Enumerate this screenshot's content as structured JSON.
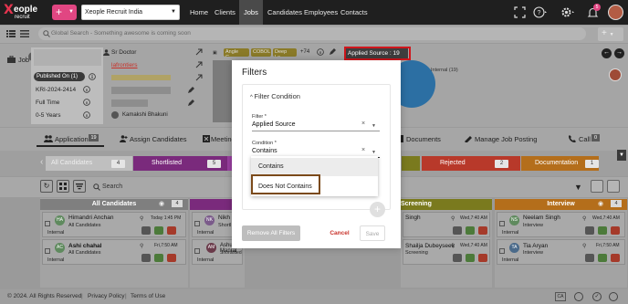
{
  "topbar": {
    "logo_x": "X",
    "logo_eople": "eople",
    "logo_recruit": "recruit",
    "add_label": "+",
    "company": "Xeople Recruit India",
    "nav": [
      "Home",
      "Clients",
      "Jobs",
      "Candidates",
      "Employees",
      "Contacts"
    ],
    "active_nav": "Jobs",
    "notification_count": "5"
  },
  "search": {
    "placeholder": "Global Search - Something awesome is coming soon"
  },
  "job": {
    "label": "Job",
    "contact": "Sr Doctor",
    "link_1": "lafrontiers",
    "published_on": "Published On (1)",
    "job_id": "KRI-2024-2414",
    "job_type": "Full Time",
    "experience": "0-5 Years",
    "owner": "Kamakshi Bhakuni",
    "skills": [
      "Angle C...",
      "COBOL",
      "Deep Le..."
    ],
    "skills_more": "+74",
    "applied_source_chip": "Applied Source : 19",
    "chart_legend": "Internal (19)"
  },
  "tabs": [
    {
      "label": "Applications",
      "count": "19"
    },
    {
      "label": "Assign Candidates"
    },
    {
      "label": "Meeting"
    },
    {
      "label": "Documents"
    },
    {
      "label": "Manage Job Posting"
    },
    {
      "label": "Call",
      "count": "0"
    }
  ],
  "pipeline": [
    {
      "label": "All Candidates",
      "count": "4"
    },
    {
      "label": "Shortlisted",
      "count": "5"
    },
    {
      "label": "Rejected",
      "count": "2"
    },
    {
      "label": "Documentation",
      "count": "1"
    }
  ],
  "toolbar": {
    "search_placeholder": "Search"
  },
  "columns": {
    "all": {
      "title": "All Candidates",
      "count": "4"
    },
    "screening": {
      "title": "Screening"
    },
    "interview": {
      "title": "Interview",
      "count": "4"
    }
  },
  "cards": {
    "c1": {
      "initials": "HA",
      "name": "Himandri Anchan",
      "stage": "All Candidates",
      "source": "Internal",
      "date": "Today 1:45 PM"
    },
    "c2": {
      "initials": "AC",
      "name": "Ashi chahal",
      "stage": "All Candidates",
      "source": "Internal",
      "date": "Fri,7:50 AM"
    },
    "c3": {
      "initials": "NK",
      "name": "Nikh",
      "stage": "Shortl",
      "source": "Internal"
    },
    "c4": {
      "initials": "AM",
      "name": "Ashu Manral",
      "stage": "Shortlisted",
      "source": "Internal",
      "date": "Fri,7:55 AM"
    },
    "c5": {
      "name": "Singh",
      "date": "Wed,7:40 AM"
    },
    "c6": {
      "name": "Shailja Dubeyseek",
      "stage": "Screening",
      "date": "Wed,7:40 AM"
    },
    "c7": {
      "initials": "NS",
      "name": "Neelam Singh",
      "stage": "Interview",
      "source": "Internal",
      "date": "Wed,7:40 AM"
    },
    "c8": {
      "initials": "TA",
      "name": "Tia Aryan",
      "stage": "Interview",
      "source": "Internal",
      "date": "Fri,7:50 AM"
    }
  },
  "modal": {
    "title": "Filters",
    "section": "Filter Condition",
    "filter_label": "Filter *",
    "filter_value": "Applied Source",
    "condition_label": "Condition *",
    "condition_value": "Contains",
    "options": [
      "Contains",
      "Does Not Contains"
    ],
    "remove_all": "Remove All Filters",
    "cancel": "Cancel",
    "save": "Save"
  },
  "footer": {
    "copyright": "© 2024. All Rights Reserved",
    "privacy": "Privacy Policy",
    "terms": "Terms of Use",
    "lang": "CA"
  },
  "colors": {
    "brand_pink": "#e14682",
    "pipeline_purple": "#7a2a7c",
    "pipeline_magenta": "#9a3fa0",
    "pipeline_red": "#b8392a",
    "pipeline_orange": "#b46e1b",
    "annotation_red": "#d0161c",
    "annotation_brown": "#7b4a1a",
    "link_red": "#c8322a"
  }
}
